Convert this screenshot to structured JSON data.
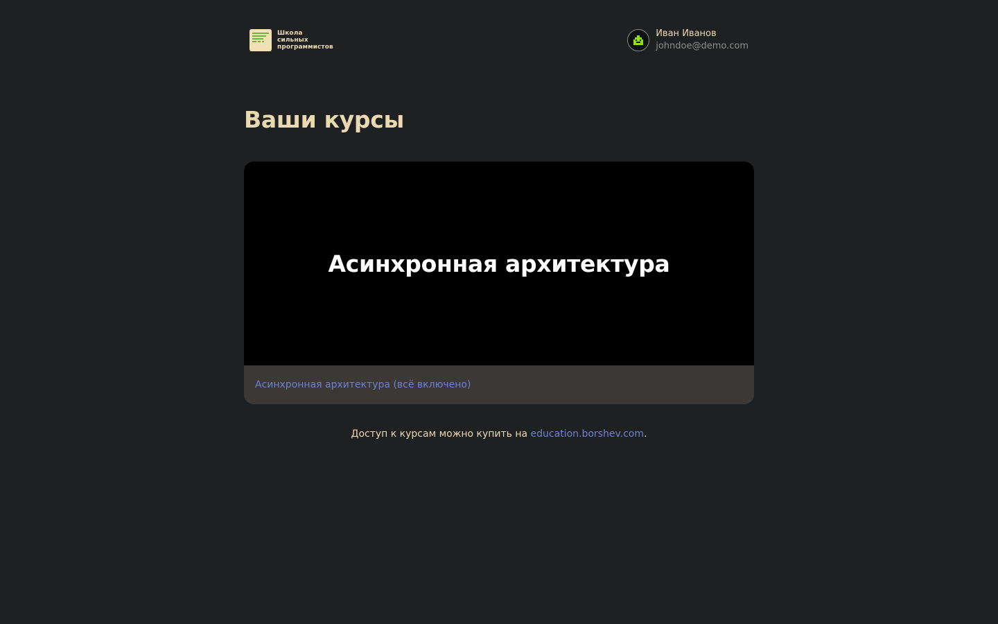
{
  "brand": {
    "line1": "Школа",
    "line2": "сильных",
    "line3": "программистов",
    "accent_color": "#6db33f",
    "mark_color": "#f0e0b4"
  },
  "user": {
    "name": "Иван Иванов",
    "email": "johndoe@demo.com",
    "avatar_icon": "pixel-avatar-icon"
  },
  "page_title": "Ваши курсы",
  "courses": [
    {
      "cover_title": "Асинхронная архитектура",
      "link_label": "Асинхронная архитектура (всё включено)"
    }
  ],
  "note": {
    "prefix": "Доступ к курсам можно купить на ",
    "link": "education.borshev.com",
    "suffix": "."
  },
  "colors": {
    "background": "#1e2022",
    "heading": "#ead9b0",
    "link": "#6e82d4",
    "card_footer": "#3c3835"
  }
}
